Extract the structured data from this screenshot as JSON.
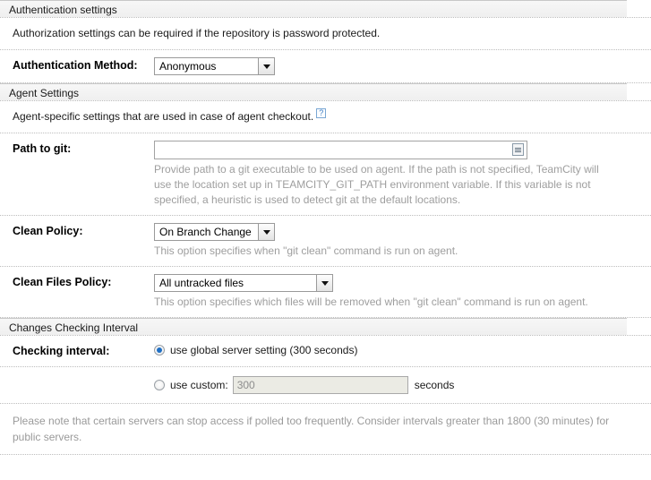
{
  "sections": {
    "authentication": {
      "header": "Authentication settings",
      "description": "Authorization settings can be required if the repository is password protected.",
      "method_label": "Authentication Method:",
      "method_value": "Anonymous"
    },
    "agent": {
      "header": "Agent Settings",
      "description": "Agent-specific settings that are used in case of agent checkout.",
      "help_icon": "question-mark-icon",
      "help_glyph": "?",
      "path_label": "Path to git:",
      "path_value": "",
      "path_placeholder": "",
      "path_hint": "Provide path to a git executable to be used on agent. If the path is not specified, TeamCity will use the location set up in TEAMCITY_GIT_PATH environment variable. If this variable is not specified, a heuristic is used to detect git at the default locations.",
      "clean_policy_label": "Clean Policy:",
      "clean_policy_value": "On Branch Change",
      "clean_policy_hint": "This option specifies when \"git clean\" command is run on agent.",
      "clean_files_label": "Clean Files Policy:",
      "clean_files_value": "All untracked files",
      "clean_files_hint": "This option specifies which files will be removed when \"git clean\" command is run on agent."
    },
    "changes": {
      "header": "Changes Checking Interval",
      "interval_label": "Checking interval:",
      "global_option_label": "use global server setting (300 seconds)",
      "global_option_selected": true,
      "custom_option_label": "use custom:",
      "custom_option_selected": false,
      "custom_value": "300",
      "custom_unit": "seconds",
      "note": "Please note that certain servers can stop access if polled too frequently. Consider intervals greater than 1800 (30 minutes) for public servers."
    }
  },
  "icons": {
    "dropdown_arrow": "chevron-down-icon",
    "input_list": "list-lines-icon"
  },
  "colors": {
    "accent": "#1f6fc4",
    "hint_text": "#9e9e9e",
    "header_bg": "#f2f2f2",
    "border": "#bdbdbd"
  }
}
